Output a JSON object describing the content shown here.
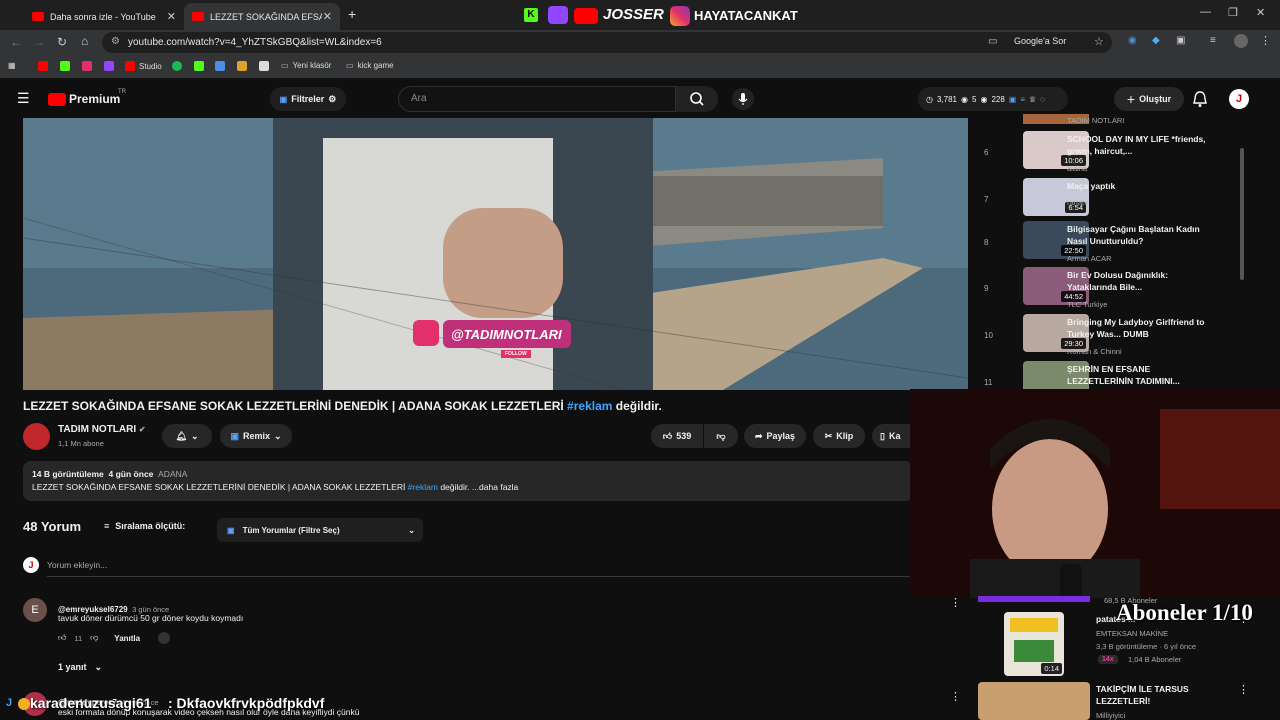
{
  "tabs": [
    {
      "label": "Daha sonra izle - YouTube"
    },
    {
      "label": "LEZZET SOKAĞINDA EFSANE SOK"
    }
  ],
  "banner": {
    "name1": "JOSSER",
    "name2": "HAYATACANKAT"
  },
  "address": {
    "url": "youtube.com/watch?v=4_YhZTSkGBQ&list=WL&index=6",
    "google_label": "Google'a Sor"
  },
  "bookmarks": [
    {
      "label": "Studio"
    },
    {
      "label": "Yeni klasör"
    },
    {
      "label": "kick game"
    }
  ],
  "header": {
    "logo": "Premium",
    "logo_suffix": "TR",
    "filters": "Filtreler",
    "search_placeholder": "Ara",
    "stat1": "3,781",
    "stat2": "5",
    "stat3": "228",
    "create": "Oluştur",
    "avatar": "J"
  },
  "video": {
    "overlay_handle": "@TADIMNOTLARI",
    "overlay_follow": "FOLLOW",
    "title_main": "LEZZET SOKAĞINDA EFSANE SOKAK LEZZETLERİNİ DENEDİK | ADANA SOKAK LEZZETLERİ",
    "title_tag": "#reklam",
    "title_end": "değildir."
  },
  "channel": {
    "name": "TADIM NOTLARI",
    "subs": "1,1 Mn abone",
    "remix": "Remix"
  },
  "actions": {
    "likes": "539",
    "share": "Paylaş",
    "clip": "Klip",
    "save": "Ka"
  },
  "description": {
    "views": "14 B görüntüleme",
    "date": "4 gün önce",
    "location": "ADANA",
    "text": "LEZZET SOKAĞINDA EFSANE SOKAK LEZZETLERİNİ DENEDİK | ADANA SOKAK LEZZETLERİ",
    "tag": "#reklam",
    "text_end": "değildir. ...daha fazla"
  },
  "comments": {
    "count": "48 Yorum",
    "sort_label": "Sıralama ölçütü:",
    "filter": "Tüm Yorumlar (Filtre Seç)",
    "add_placeholder": "Yorum ekleyin...",
    "add_avatar": "J",
    "items": [
      {
        "avatar": "E",
        "user": "@emreyuksel6729",
        "time": "3 gün önce",
        "text": "tavuk döner dürümcü 50 gr döner koydu koymadı",
        "likes": "11",
        "reply": "Yanıtla",
        "replies": "1 yanıt"
      },
      {
        "user": "@maddyperez7",
        "time": "4 gün önce",
        "text": "eski formata dönüp konuşarak video çekseh nasıl olur öyle daha keyifliydi çünkü"
      }
    ]
  },
  "sidebar": {
    "top_channel": "TADIM NOTLARI",
    "items": [
      {
        "num": "6",
        "title": "SCHOOL DAY IN MY LIFE *friends, grwm, haircut,...",
        "channel": "alaina",
        "duration": "10:06",
        "color": "#d9c9c9"
      },
      {
        "num": "7",
        "title": "Maça yaptık",
        "channel": "ranatv",
        "duration": "6:54",
        "color": "#c7c9d8"
      },
      {
        "num": "8",
        "title": "Bilgisayar Çağını Başlatan Kadın Nasıl Unutturuldu?",
        "channel": "Arman ACAR",
        "duration": "22:50",
        "color": "#3a4a5a"
      },
      {
        "num": "9",
        "title": "Bir Ev Dolusu Dağınıklık: Yataklarında Bile...",
        "channel": "TLC Turkiye",
        "duration": "44:52",
        "color": "#8a5c7a"
      },
      {
        "num": "10",
        "title": "Bringing My Ladyboy Girlfriend to Turkey Was... DUMB",
        "channel": "Roman & Chinni",
        "duration": "29:30",
        "color": "#b7a8a0"
      },
      {
        "num": "11",
        "title": "ŞEHRİN EN EFSANE LEZZETLERİNİN TADIMINI...",
        "channel": "",
        "duration": "",
        "color": "#7a8a6a"
      }
    ],
    "rec1": {
      "title": "patates ...",
      "channel": "EMTEKSAN MAKİNE",
      "meta": "3,3 B görüntüleme · 6 yıl önce",
      "duration": "0:14",
      "badge": "14x",
      "subs": "1,04 B Aboneler"
    },
    "rec2": {
      "title": "TAKİPÇİM İLE TARSUS LEZZETLERİ!",
      "channel": "Milliyiyici",
      "partial_subs": "68,5 B Aboneler"
    }
  },
  "stream": {
    "subs_counter": "Aboneler 1/10",
    "chat_user": "karadenuzusagi61",
    "chat_text": ": Dkfaovkfrvkpödfpkdvf"
  }
}
